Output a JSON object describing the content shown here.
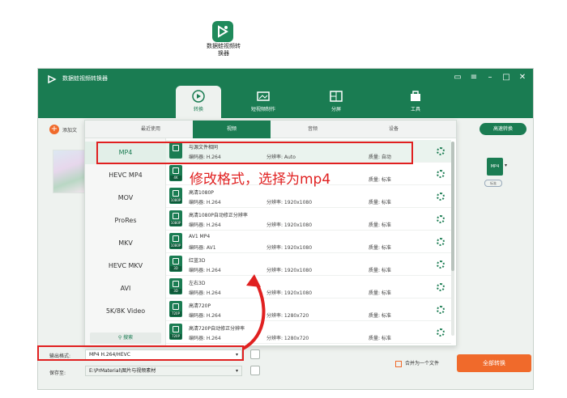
{
  "desktop": {
    "icon": "app-icon",
    "label_line1": "数据蛙视频转",
    "label_line2": "换器"
  },
  "window": {
    "title": "数据蛙视频转换器",
    "controls": [
      "message-icon",
      "menu-icon",
      "minimize-icon",
      "maximize-icon",
      "close-icon"
    ]
  },
  "nav": [
    {
      "label": "转换",
      "icon": "convert-icon",
      "active": true
    },
    {
      "label": "短视频制作",
      "icon": "short-video-icon",
      "active": false
    },
    {
      "label": "分屏",
      "icon": "split-screen-icon",
      "active": false
    },
    {
      "label": "工具",
      "icon": "toolbox-icon",
      "active": false
    }
  ],
  "toolbar": {
    "add_label": "添加文",
    "speed_label": "高速转换"
  },
  "format_panel": {
    "tabs": [
      "最近使用",
      "视频",
      "音频",
      "设备"
    ],
    "active_tab": 1,
    "formats": [
      "MP4",
      "HEVC MP4",
      "MOV",
      "ProRes",
      "MKV",
      "HEVC MKV",
      "AVI",
      "5K/8K Video"
    ],
    "active_format": 0,
    "search_label": "搜索",
    "presets": [
      {
        "name": "与源文件相同",
        "badge": "",
        "encoder": "编码器:   H.264",
        "resolution": "分辨率:   Auto",
        "quality": "质量:   自动"
      },
      {
        "name": "",
        "badge": "4K",
        "encoder": "",
        "resolution": "",
        "quality": "质量:   标准"
      },
      {
        "name": "高清1080P",
        "badge": "1080P",
        "encoder": "编码器:   H.264",
        "resolution": "分辨率:   1920x1080",
        "quality": "质量:   标准"
      },
      {
        "name": "高清1080P自动修正分辨率",
        "badge": "1080P",
        "encoder": "编码器:   H.264",
        "resolution": "分辨率:   1920x1080",
        "quality": "质量:   标准"
      },
      {
        "name": "AV1 MP4",
        "badge": "1080P",
        "encoder": "编码器:   AV1",
        "resolution": "分辨率:   1920x1080",
        "quality": "质量:   标准"
      },
      {
        "name": "红蓝3D",
        "badge": "3D",
        "encoder": "编码器:   H.264",
        "resolution": "分辨率:   1920x1080",
        "quality": "质量:   标准"
      },
      {
        "name": "左右3D",
        "badge": "3D",
        "encoder": "编码器:   H.264",
        "resolution": "分辨率:   1920x1080",
        "quality": "质量:   标准"
      },
      {
        "name": "高清720P",
        "badge": "720P",
        "encoder": "编码器:   H.264",
        "resolution": "分辨率:   1280x720",
        "quality": "质量:   标准"
      },
      {
        "name": "高清720P自动修正分辨率",
        "badge": "720P",
        "encoder": "编码器:   H.264",
        "resolution": "分辨率:   1280x720",
        "quality": "质量:   标准"
      }
    ]
  },
  "annotation": "修改格式，选择为mp4",
  "bottom": {
    "output_label": "输出格式:",
    "output_value": "MP4 H.264/HEVC",
    "save_label": "保存至:",
    "save_value": "E:\\PrMaterial\\图片与视频素材",
    "merge_label": "合并为一个文件",
    "convert_all": "全部转换"
  },
  "file_item": {
    "format_badge": "MP4",
    "chip": "标准"
  },
  "colors": {
    "brand": "#1a7c52",
    "accent": "#f06a2b",
    "annotation": "#e02020"
  }
}
